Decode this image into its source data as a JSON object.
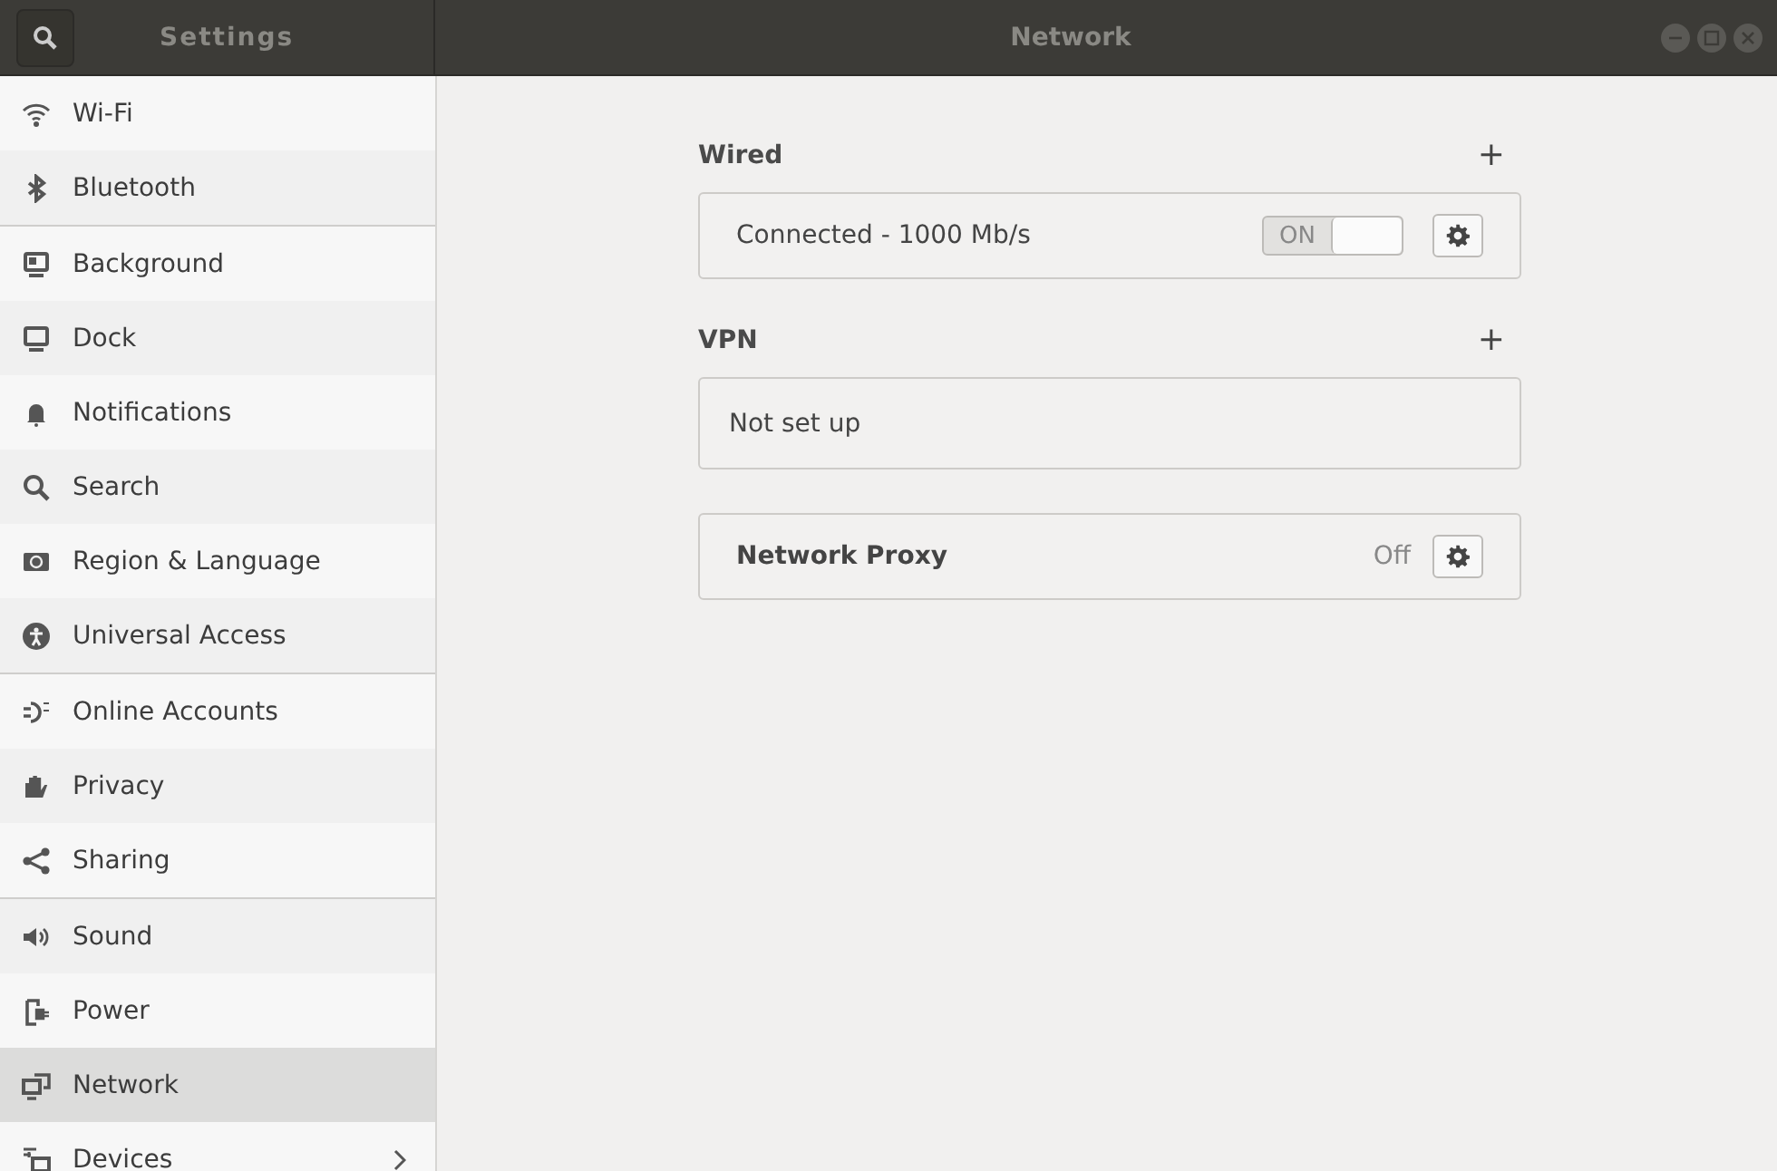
{
  "titlebar": {
    "left_title": "Settings",
    "title": "Network"
  },
  "sidebar": {
    "groups": [
      [
        {
          "label": "Wi-Fi",
          "selected": false,
          "submenu": false
        },
        {
          "label": "Bluetooth",
          "selected": false,
          "submenu": false
        }
      ],
      [
        {
          "label": "Background",
          "selected": false,
          "submenu": false
        },
        {
          "label": "Dock",
          "selected": false,
          "submenu": false
        },
        {
          "label": "Notifications",
          "selected": false,
          "submenu": false
        },
        {
          "label": "Search",
          "selected": false,
          "submenu": false
        },
        {
          "label": "Region & Language",
          "selected": false,
          "submenu": false
        },
        {
          "label": "Universal Access",
          "selected": false,
          "submenu": false
        }
      ],
      [
        {
          "label": "Online Accounts",
          "selected": false,
          "submenu": false
        },
        {
          "label": "Privacy",
          "selected": false,
          "submenu": false
        },
        {
          "label": "Sharing",
          "selected": false,
          "submenu": false
        }
      ],
      [
        {
          "label": "Sound",
          "selected": false,
          "submenu": false
        },
        {
          "label": "Power",
          "selected": false,
          "submenu": false
        },
        {
          "label": "Network",
          "selected": true,
          "submenu": false
        },
        {
          "label": "Devices",
          "selected": false,
          "submenu": true
        }
      ]
    ]
  },
  "sections": [
    {
      "title": "Wired",
      "add": "+",
      "rows": [
        {
          "kind": "toggle",
          "label": "Connected - 1000 Mb/s",
          "switch_label": "ON",
          "on": true
        }
      ]
    },
    {
      "title": "VPN",
      "add": "+",
      "rows": [
        {
          "kind": "empty",
          "label": "Not set up"
        }
      ]
    },
    {
      "rows": [
        {
          "kind": "proxy",
          "label": "Network Proxy",
          "value": "Off"
        }
      ]
    }
  ]
}
